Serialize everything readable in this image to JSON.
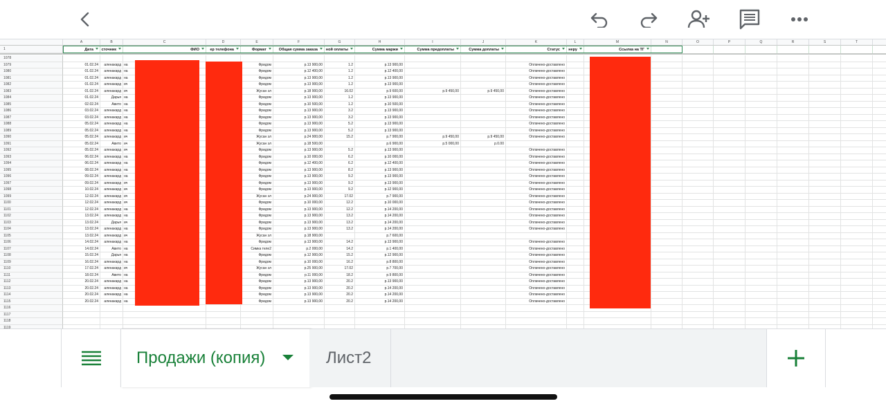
{
  "toolbar": {
    "icons": [
      "chevron-left-icon",
      "undo-icon",
      "redo-icon",
      "add-person-icon",
      "comment-icon",
      "more-icon"
    ]
  },
  "columns": [
    "A",
    "B",
    "C",
    "D",
    "E",
    "F",
    "G",
    "H",
    "I",
    "J",
    "K",
    "L",
    "M",
    "N",
    "O",
    "P",
    "Q",
    "R",
    "S",
    "T",
    "U"
  ],
  "header_row_number": "1",
  "headers": [
    "Дата",
    "сточник",
    "ФИО",
    "ер телефона",
    "Формат",
    "Общая сумма заказа",
    "ной оплаты",
    "Сумма маржи",
    "Сумма предоплаты",
    "Сумма доплаты",
    "Статус",
    "неру",
    "Ссылка на ТГ",
    "",
    "",
    "",
    "",
    "",
    "",
    "",
    ""
  ],
  "top_empty_row": "1078",
  "rows": [
    [
      "1079",
      "01.02.24",
      "аленакард",
      "на",
      "",
      "Фридом",
      "р.13 900,00",
      "1.2",
      "р.13 900,00",
      "",
      "",
      "Оплачено-доставлено"
    ],
    [
      "1080",
      "01.02.24",
      "аленакард",
      "на",
      "",
      "Фридом",
      "р.12 400,00",
      "1.2",
      "р.12 400,00",
      "",
      "",
      "Оплачено-доставлено"
    ],
    [
      "1081",
      "01.02.24",
      "аленакард",
      "на",
      "",
      "Фридом",
      "р.13 900,00",
      "1.2",
      "р.13 900,00",
      "",
      "",
      "Оплачено-доставлено"
    ],
    [
      "1082",
      "01.02.24",
      "аленакард",
      "ич",
      "",
      "Фридом",
      "р.13 900,00",
      "1.2",
      "р.13 900,00",
      "",
      "",
      "Оплачено-доставлено"
    ],
    [
      "1083",
      "01.02.24",
      "аленакард",
      "ич",
      "",
      "Жусан эл",
      "р.18 900,00",
      "16.02",
      "р.9 600,00",
      "р.9 450,00",
      "р.9 450,00",
      "Оплачено-доставлено"
    ],
    [
      "1084",
      "01.02.24",
      "Дарья",
      "на",
      "",
      "Фридом",
      "р.13 900,00",
      "1.2",
      "р.13 900,00",
      "",
      "",
      "Оплачено-доставлено"
    ],
    [
      "1085",
      "02.02.24",
      "Авито",
      "на",
      "",
      "Фридом",
      "р.10 500,00",
      "1.2",
      "р.10 500,00",
      "",
      "",
      "Оплачено-доставлено"
    ],
    [
      "1086",
      "03.02.24",
      "аленакард",
      "на",
      "",
      "Фридом",
      "р.13 900,00",
      "3.2",
      "р.13 900,00",
      "",
      "",
      "Оплачено-доставлено"
    ],
    [
      "1087",
      "03.02.24",
      "аленакард",
      "на",
      "",
      "Фридом",
      "р.13 900,00",
      "3.2",
      "р.13 900,00",
      "",
      "",
      "Оплачено-доставлено"
    ],
    [
      "1088",
      "05.02.24",
      "аленакард",
      "на",
      "",
      "Фридом",
      "р.13 900,00",
      "5.2",
      "р.13 900,00",
      "",
      "",
      "Оплачено-доставлено"
    ],
    [
      "1089",
      "05.02.24",
      "аленакард",
      "на",
      "",
      "Фридом",
      "р.13 900,00",
      "5.2",
      "р.13 900,00",
      "",
      "",
      "Оплачено-доставлено"
    ],
    [
      "1090",
      "05.02.24",
      "аленакард",
      "ич",
      "",
      "Жусан эл",
      "р.24 900,00",
      "15.2",
      "р.7 900,00",
      "р.9 450,00",
      "р.9 450,00",
      "Оплачено-доставлено"
    ],
    [
      "1091",
      "05.02.24",
      "Авито",
      "ич",
      "",
      "Жусан эл",
      "р.18 500,00",
      "",
      "р.6 900,00",
      "р.5 000,00",
      "р.0.00",
      ""
    ],
    [
      "1092",
      "05.02.24",
      "аленакард",
      "ич",
      "",
      "Фридом",
      "р.13 900,00",
      "5.2",
      "р.13 900,00",
      "",
      "",
      "Оплачено-доставлено"
    ],
    [
      "1093",
      "06.02.24",
      "аленакард",
      "на",
      "",
      "Фридом",
      "р.10 000,00",
      "6.2",
      "р.10 000,00",
      "",
      "",
      "Оплачено-доставлено"
    ],
    [
      "1094",
      "06.02.24",
      "аленакард",
      "на",
      "",
      "Фридом",
      "р.12 400,00",
      "6.2",
      "р.12 400,00",
      "",
      "",
      "Оплачено-доставлено"
    ],
    [
      "1095",
      "08.02.24",
      "аленакард",
      "на",
      "",
      "Фридом",
      "р.13 900,00",
      "8.2",
      "р.13 900,00",
      "",
      "",
      "Оплачено-доставлено"
    ],
    [
      "1096",
      "09.02.24",
      "аленакард",
      "на",
      "",
      "Фридом",
      "р.13 900,00",
      "9.2",
      "р.13 900,00",
      "",
      "",
      "Оплачено-доставлено"
    ],
    [
      "1097",
      "09.02.24",
      "аленакард",
      "ич",
      "",
      "Фридом",
      "р.13 900,00",
      "9.2",
      "р.13 900,00",
      "",
      "",
      "Оплачено-доставлено"
    ],
    [
      "1098",
      "10.02.24",
      "аленакард",
      "ич",
      "",
      "Фридом",
      "р.13 900,00",
      "9.2",
      "р.12 900,00",
      "",
      "",
      "Оплачено-доставлено"
    ],
    [
      "1099",
      "12.02.24",
      "аленакард",
      "ич",
      "",
      "Жусан эл",
      "р.24 900,00",
      "17.02",
      "р.7 900,00",
      "",
      "",
      "Оплачено-доставлено"
    ],
    [
      "1100",
      "12.02.24",
      "аленакард",
      "ич",
      "",
      "Фридом",
      "р.10 000,00",
      "12.2",
      "р.10 000,00",
      "",
      "",
      "Оплачено-доставлено"
    ],
    [
      "1101",
      "12.02.24",
      "аленакард",
      "на",
      "",
      "Фридом",
      "р.13 900,00",
      "12.2",
      "р.14 200,00",
      "",
      "",
      "Оплачено-доставлено"
    ],
    [
      "1102",
      "13.02.24",
      "аленакард",
      "на",
      "",
      "Фридом",
      "р.13 900,00",
      "13.2",
      "р.14 200,00",
      "",
      "",
      "Оплачено-доставлено"
    ],
    [
      "1103",
      "13.02.24",
      "Дарья",
      "ич",
      "",
      "Фридом",
      "р.13 900,00",
      "13.2",
      "р.14 200,00",
      "",
      "",
      "Оплачено-доставлено"
    ],
    [
      "1104",
      "13.02.24",
      "аленакард",
      "на",
      "",
      "Фридом",
      "р.13 900,00",
      "13.2",
      "р.14 200,00",
      "",
      "",
      "Оплачено-доставлено"
    ],
    [
      "1105",
      "13.02.24",
      "аленакард",
      "ич",
      "",
      "Жусан эл",
      "р.18 900,00",
      "",
      "р.7 600,00",
      "",
      "",
      ""
    ],
    [
      "1106",
      "14.02.24",
      "аленакард",
      "на",
      "",
      "Фридом",
      "р.13 900,00",
      "14.2",
      "р.13 900,00",
      "",
      "",
      "Оплачено-доставлено"
    ],
    [
      "1107",
      "14.02.24",
      "Авито",
      "на",
      "",
      "Симка теле2",
      "р.2 000,00",
      "14.2",
      "р.1 400,00",
      "",
      "",
      "Оплачено-доставлено"
    ],
    [
      "1108",
      "15.02.24",
      "Дарья",
      "на",
      "",
      "Фридом",
      "р.12 900,00",
      "15.2",
      "р.12 900,00",
      "",
      "",
      "Оплачено-доставлено"
    ],
    [
      "1109",
      "16.02.24",
      "аленакард",
      "на",
      "",
      "Фридом",
      "р.10 000,00",
      "16.2",
      "р.8 800,00",
      "",
      "",
      "Оплачено-доставлено"
    ],
    [
      "1110",
      "17.02.24",
      "аленакард",
      "ич",
      "",
      "Жусан эл",
      "р.25 900,00",
      "17.02",
      "р.7 700,00",
      "",
      "",
      "Оплачено-доставлено"
    ],
    [
      "1111",
      "18.02.24",
      "Авито",
      "на",
      "",
      "Фридом",
      "р.11 000,00",
      "18.2",
      "р.9 800,00",
      "",
      "",
      "Оплачено-доставлено"
    ],
    [
      "1112",
      "20.02.24",
      "аленакард",
      "на",
      "",
      "Фридом",
      "р.13 900,00",
      "20.2",
      "р.13 900,00",
      "",
      "",
      "Оплачено-доставлено"
    ],
    [
      "1113",
      "20.02.24",
      "аленакард",
      "на",
      "",
      "Фридом",
      "р.13 900,00",
      "20.2",
      "р.14 200,00",
      "",
      "",
      "Оплачено-доставлено"
    ],
    [
      "1114",
      "20.02.24",
      "аленакард",
      "на",
      "",
      "Фридом",
      "р.13 900,00",
      "20.2",
      "р.14 200,00",
      "",
      "",
      "Оплачено-доставлено"
    ],
    [
      "1115",
      "20.02.24",
      "аленакард",
      "на",
      "",
      "Фридом",
      "р.13 900,00",
      "20.2",
      "р.14 200,00",
      "",
      "",
      "Оплачено-доставлено"
    ]
  ],
  "trailing_rows": [
    "1116",
    "1117",
    "1118",
    "1119"
  ],
  "tabs": {
    "active_label": "Продажи (копия)",
    "inactive_label": "Лист2"
  },
  "colors": {
    "accent_green": "#188038",
    "redaction": "#ff2a0e",
    "selection": "#2f8a54"
  }
}
